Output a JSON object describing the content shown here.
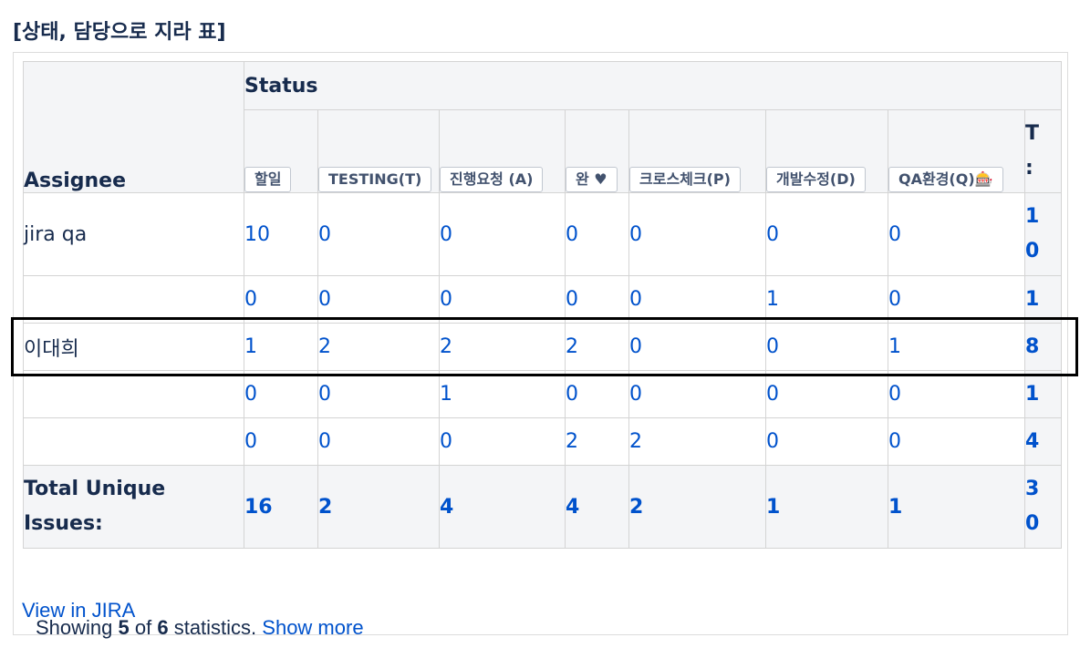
{
  "title": "[상태, 담당으로 지라 표]",
  "table": {
    "assignee_header": "Assignee",
    "status_header": "Status",
    "columns": [
      "할일",
      "TESTING(T)",
      "진행요청 (A)",
      "완 ♥",
      "크로스체크(P)",
      "개발수정(D)",
      "QA환경(Q)🎰"
    ],
    "total_header": "T\n:",
    "rows": [
      {
        "assignee": "jira qa",
        "values": [
          "10",
          "0",
          "0",
          "0",
          "0",
          "0",
          "0"
        ],
        "total": "1\n0"
      },
      {
        "assignee": "",
        "values": [
          "0",
          "0",
          "0",
          "0",
          "0",
          "1",
          "0"
        ],
        "total": "1"
      },
      {
        "assignee": "이대희",
        "values": [
          "1",
          "2",
          "2",
          "2",
          "0",
          "0",
          "1"
        ],
        "total": "8"
      },
      {
        "assignee": "",
        "values": [
          "0",
          "0",
          "1",
          "0",
          "0",
          "0",
          "0"
        ],
        "total": "1"
      },
      {
        "assignee": "",
        "values": [
          "0",
          "0",
          "0",
          "2",
          "2",
          "0",
          "0"
        ],
        "total": "4"
      }
    ],
    "footer": {
      "label": "Total Unique\nIssues:",
      "values": [
        "16",
        "2",
        "4",
        "4",
        "2",
        "1",
        "1"
      ],
      "total": "3\n0"
    }
  },
  "summary": {
    "prefix": "Showing ",
    "shown": "5",
    "of": " of ",
    "total": "6",
    "suffix": " statistics. ",
    "show_more": "Show more"
  },
  "view_link": "View in JIRA"
}
